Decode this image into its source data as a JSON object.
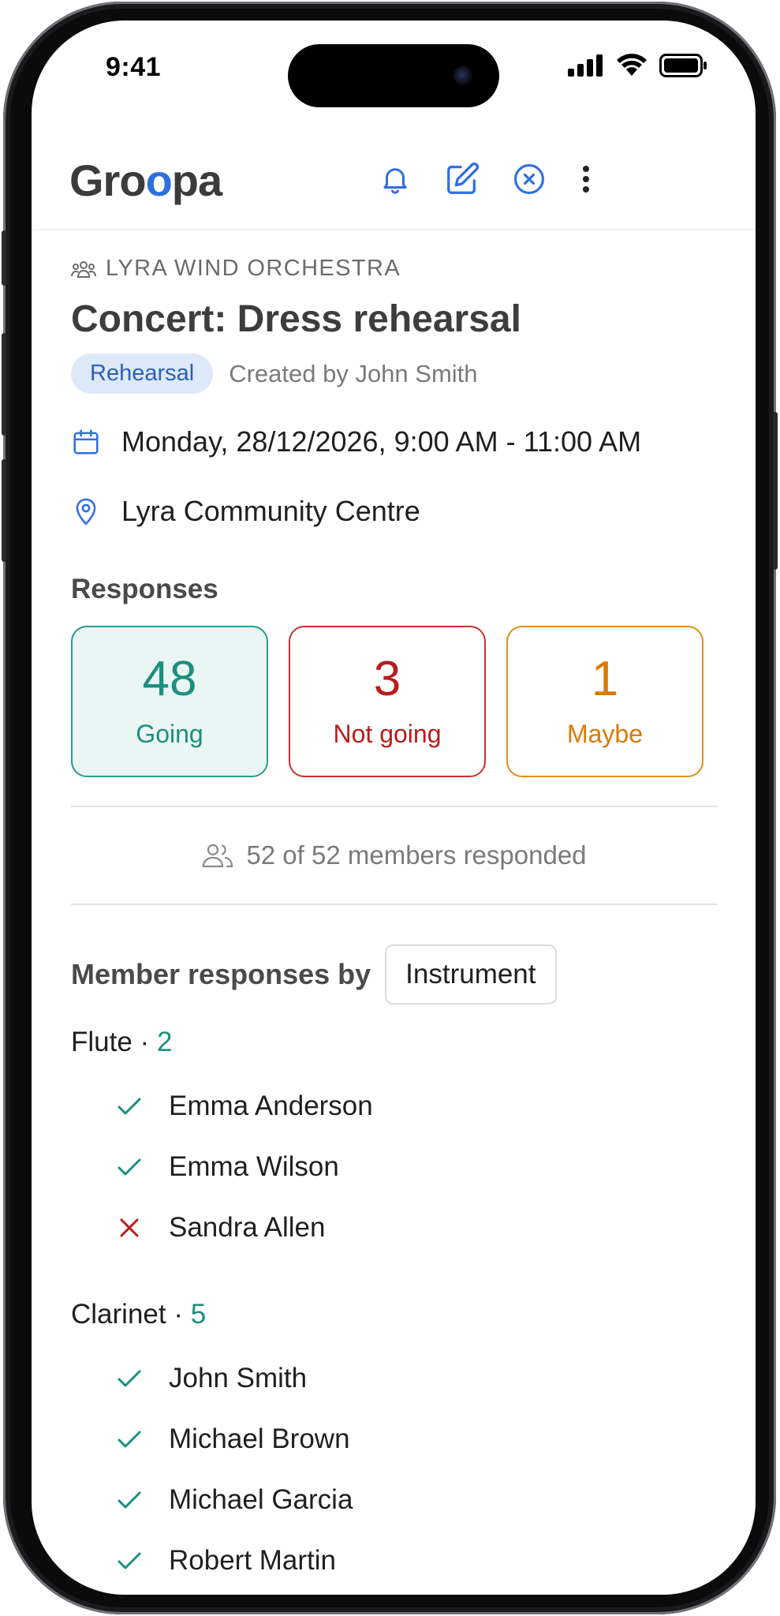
{
  "status_bar": {
    "time": "9:41"
  },
  "app": {
    "logo_prefix": "Gr",
    "logo_o1": "o",
    "logo_o2": "o",
    "logo_suffix": "pa"
  },
  "event": {
    "organization": "LYRA WIND ORCHESTRA",
    "title": "Concert: Dress rehearsal",
    "type_badge": "Rehearsal",
    "created_by": "Created by John Smith",
    "datetime": "Monday, 28/12/2026, 9:00 AM - 11:00 AM",
    "location": "Lyra Community Centre"
  },
  "responses": {
    "title": "Responses",
    "going": {
      "count": "48",
      "label": "Going"
    },
    "not_going": {
      "count": "3",
      "label": "Not going"
    },
    "maybe": {
      "count": "1",
      "label": "Maybe"
    },
    "summary": "52 of 52 members responded"
  },
  "member_responses": {
    "title": "Member responses by",
    "group_by": "Instrument",
    "groups": [
      {
        "name": "Flute",
        "separator": "·",
        "count": "2",
        "members": [
          {
            "name": "Emma Anderson",
            "status": "going"
          },
          {
            "name": "Emma Wilson",
            "status": "going"
          },
          {
            "name": "Sandra Allen",
            "status": "not-going"
          }
        ]
      },
      {
        "name": "Clarinet",
        "separator": "·",
        "count": "5",
        "members": [
          {
            "name": "John Smith",
            "status": "going"
          },
          {
            "name": "Michael Brown",
            "status": "going"
          },
          {
            "name": "Michael Garcia",
            "status": "going"
          },
          {
            "name": "Robert Martin",
            "status": "going"
          }
        ]
      }
    ]
  },
  "colors": {
    "accent": "#2f6fe0",
    "going": "#1c8f7d",
    "not_going": "#b91c1c",
    "maybe": "#d97a06"
  }
}
